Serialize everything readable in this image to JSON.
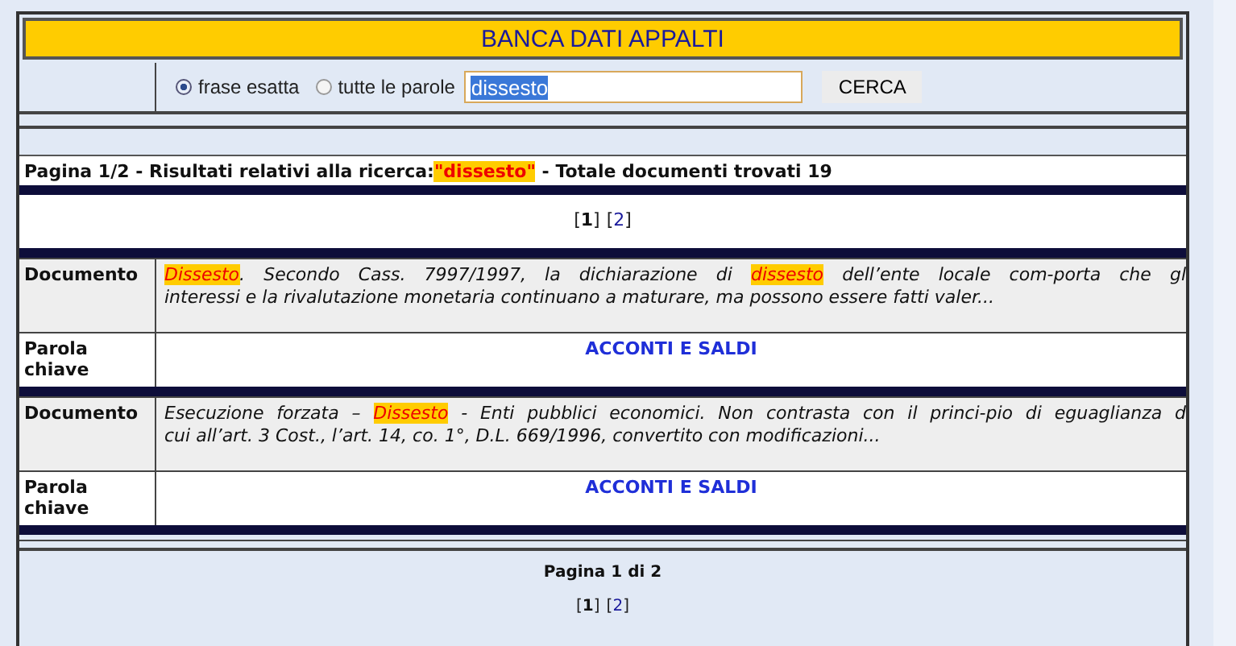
{
  "title": "BANCA DATI APPALTI",
  "search": {
    "options": [
      {
        "label": "frase esatta",
        "selected": true
      },
      {
        "label": "tutte le parole",
        "selected": false
      }
    ],
    "value": "dissesto",
    "button": "CERCA"
  },
  "results_header": {
    "prefix": "Pagina 1/2 - Risultati relativi alla ricerca:",
    "term": "\"dissesto\"",
    "suffix": "- Totale documenti trovati 19"
  },
  "pager_top": [
    {
      "open": "[",
      "label": "1",
      "close": "]",
      "selected": true
    },
    {
      "open": "[",
      "label": "2",
      "close": "]",
      "selected": false
    }
  ],
  "documents": [
    {
      "label": "Documento",
      "lines": [
        [
          {
            "text": "Dissesto",
            "highlight": true
          },
          {
            "text": ". Secondo Cass. 7997/1997, la dichiarazione di ",
            "highlight": false
          },
          {
            "text": "dissesto",
            "highlight": true
          },
          {
            "text": " dell’ente locale com-porta che gl",
            "highlight": false
          }
        ],
        [
          {
            "text": "interessi e la rivalutazione monetaria continuano a maturare, ma possono essere fatti valer...",
            "highlight": false
          }
        ]
      ],
      "keyword_label": "Parola chiave",
      "keyword": "ACCONTI E SALDI"
    },
    {
      "label": "Documento",
      "lines": [
        [
          {
            "text": "Esecuzione forzata – ",
            "highlight": false
          },
          {
            "text": "Dissesto",
            "highlight": true
          },
          {
            "text": " - Enti pubblici economici. Non contrasta con il princi-pio di eguaglianza d",
            "highlight": false
          }
        ],
        [
          {
            "text": "cui all’art. 3 Cost., l’art. 14, co. 1°, D.L. 669/1996, convertito con modificazioni...",
            "highlight": false
          }
        ]
      ],
      "keyword_label": "Parola chiave",
      "keyword": "ACCONTI E SALDI"
    }
  ],
  "footer": {
    "page_info": "Pagina 1 di 2",
    "pager": [
      {
        "open": "[",
        "label": "1",
        "close": "]",
        "selected": true
      },
      {
        "open": "[",
        "label": "2",
        "close": "]",
        "selected": false
      }
    ]
  }
}
